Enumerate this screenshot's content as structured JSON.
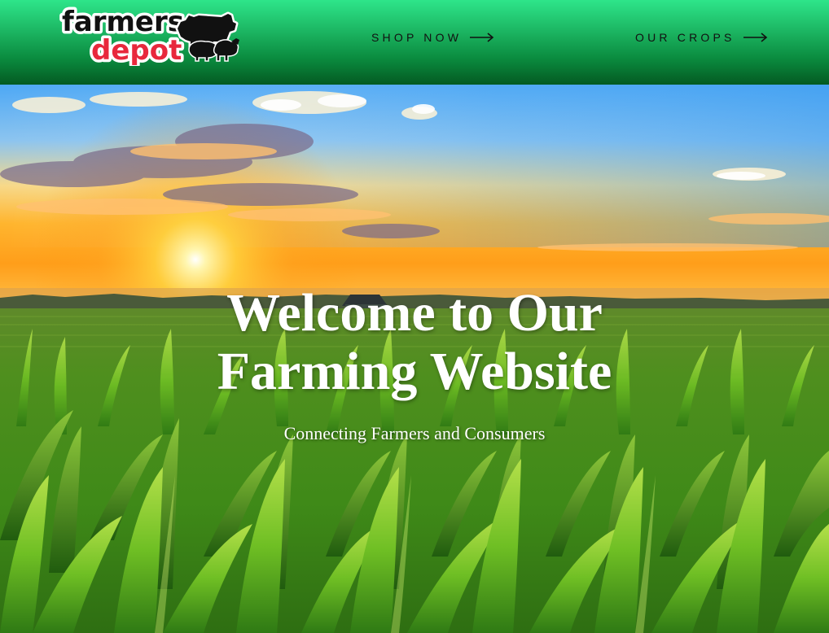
{
  "header": {
    "logo": {
      "line1": "farmers",
      "line2": "depot"
    },
    "nav": [
      {
        "label": "SHOP NOW",
        "icon": "arrow-right-icon"
      },
      {
        "label": "OUR CROPS",
        "icon": "arrow-right-icon"
      }
    ]
  },
  "hero": {
    "title_line1": "Welcome to Our",
    "title_line2": "Farming Website",
    "subtitle": "Connecting Farmers and Consumers"
  },
  "colors": {
    "header_top": "#2ee58a",
    "header_bottom": "#045a22",
    "logo_red": "#e8283c",
    "hero_text": "#ffffff"
  }
}
